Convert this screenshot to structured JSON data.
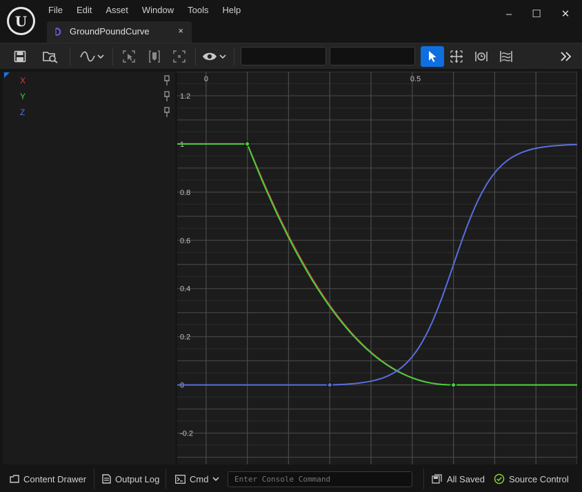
{
  "menu": [
    "File",
    "Edit",
    "Asset",
    "Window",
    "Tools",
    "Help"
  ],
  "tab": {
    "title": "GroundPoundCurve",
    "close": "×"
  },
  "window_controls": {
    "minimize": "–",
    "maximize": "☐",
    "close": "✕"
  },
  "curves": [
    {
      "name": "X",
      "color": "#e03c3c"
    },
    {
      "name": "Y",
      "color": "#3cd23c"
    },
    {
      "name": "Z",
      "color": "#5a6ee0"
    }
  ],
  "toolbar": {
    "search_value": "",
    "filter_value": ""
  },
  "graph": {
    "x_ticks": [
      {
        "value": 0,
        "label": "0"
      },
      {
        "value": 0.5,
        "label": "0.5"
      }
    ],
    "y_ticks": [
      {
        "value": 1.2,
        "label": "1.2"
      },
      {
        "value": 1.0,
        "label": "1"
      },
      {
        "value": 0.8,
        "label": "0.8"
      },
      {
        "value": 0.6,
        "label": "0.6"
      },
      {
        "value": 0.4,
        "label": "0.4"
      },
      {
        "value": 0.2,
        "label": "0.2"
      },
      {
        "value": 0,
        "label": "0"
      },
      {
        "value": -0.2,
        "label": "-0.2"
      }
    ],
    "x_range": [
      -0.07,
      0.9
    ],
    "y_range": [
      -0.33,
      1.3
    ],
    "series": [
      {
        "name": "X",
        "color": "#d94040",
        "keys": [
          [
            0.1,
            1.0
          ],
          [
            0.6,
            0.0
          ]
        ]
      },
      {
        "name": "Y",
        "color": "#44d23c",
        "keys": [
          [
            0.1,
            1.0
          ],
          [
            0.6,
            0.0
          ]
        ]
      },
      {
        "name": "Z",
        "color": "#5a6ee0",
        "keys": [
          [
            0.3,
            0.0
          ],
          [
            0.9,
            1.0
          ]
        ]
      }
    ]
  },
  "statusbar": {
    "content_drawer": "Content Drawer",
    "output_log": "Output Log",
    "cmd": "Cmd",
    "console_placeholder": "Enter Console Command",
    "all_saved": "All Saved",
    "source_control": "Source Control"
  }
}
